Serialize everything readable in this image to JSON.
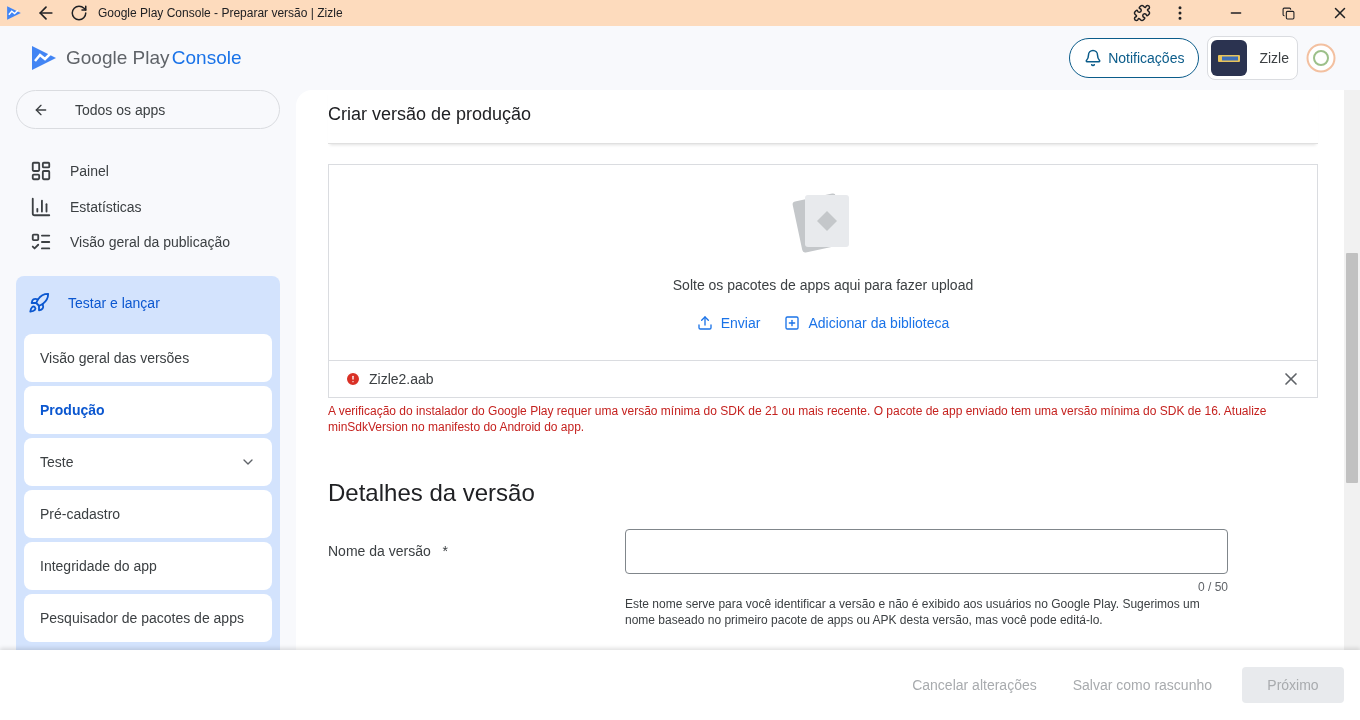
{
  "window": {
    "title": "Google Play Console - Preparar versão | Zizle"
  },
  "header": {
    "brand": "Google Play",
    "product": "Console",
    "notifications": "Notificações",
    "app_name": "Zizle"
  },
  "sidebar": {
    "back": "Todos os apps",
    "items": [
      {
        "label": "Painel",
        "kind": "dashboard"
      },
      {
        "label": "Estatísticas",
        "kind": "stats"
      },
      {
        "label": "Visão geral da publicação",
        "kind": "schedule"
      }
    ],
    "group": {
      "label": "Testar e lançar",
      "expanded": true,
      "children": [
        {
          "label": "Visão geral das versões",
          "selected": false,
          "expandable": false
        },
        {
          "label": "Produção",
          "selected": true,
          "expandable": false
        },
        {
          "label": "Teste",
          "selected": false,
          "expandable": true
        },
        {
          "label": "Pré-cadastro",
          "selected": false,
          "expandable": false
        },
        {
          "label": "Integridade do app",
          "selected": false,
          "expandable": false
        },
        {
          "label": "Pesquisador de pacotes de apps",
          "selected": false,
          "expandable": false
        }
      ]
    }
  },
  "page": {
    "title": "Criar versão de produção",
    "upload": {
      "hint": "Solte os pacotes de apps aqui para fazer upload",
      "send": "Enviar",
      "library": "Adicionar da biblioteca",
      "file": {
        "name": "Zizle2.aab",
        "error": true
      },
      "error_text": "A verificação do instalador do Google Play requer uma versão mínima do SDK de 21 ou mais recente. O pacote de app enviado tem uma versão mínima do SDK de 16. Atualize minSdkVersion no manifesto do Android do app."
    },
    "details": {
      "title": "Detalhes da versão",
      "label": "Nome da versão",
      "required": "*",
      "counter": "0 / 50",
      "help": "Este nome serve para você identificar a versão e não é exibido aos usuários no Google Play. Sugerimos um nome baseado no primeiro pacote de apps ou APK desta versão, mas você pode editá-lo."
    }
  },
  "footer": [
    {
      "label": "Cancelar alterações",
      "kind": "text",
      "disabled": true
    },
    {
      "label": "Salvar como rascunho",
      "kind": "text",
      "disabled": true
    },
    {
      "label": "Próximo",
      "kind": "filled",
      "disabled": true
    }
  ]
}
